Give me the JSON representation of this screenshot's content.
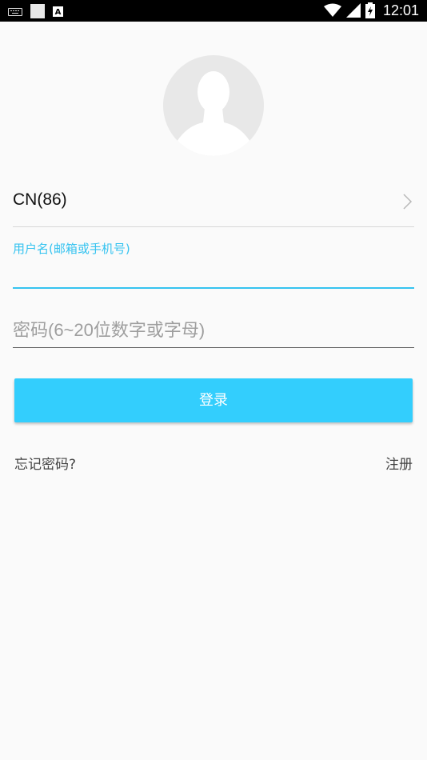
{
  "status_bar": {
    "time": "12:01",
    "left_icons": [
      "keyboard-icon",
      "square-icon",
      "a-icon"
    ],
    "a_icon_glyph": "A",
    "right_icons": [
      "wifi-icon",
      "signal-icon",
      "battery-icon"
    ]
  },
  "avatar": {
    "icon": "default-avatar-icon"
  },
  "country": {
    "label": "CN(86)",
    "icon": "chevron-right-icon"
  },
  "username": {
    "label": "用户名(邮箱或手机号)",
    "value": ""
  },
  "password": {
    "placeholder": "密码(6~20位数字或字母)",
    "value": ""
  },
  "login_button": {
    "label": "登录",
    "color": "#33cefd"
  },
  "links": {
    "forgot": "忘记密码?",
    "register": "注册"
  },
  "colors": {
    "accent": "#35c3f0",
    "background": "#fafafa"
  }
}
